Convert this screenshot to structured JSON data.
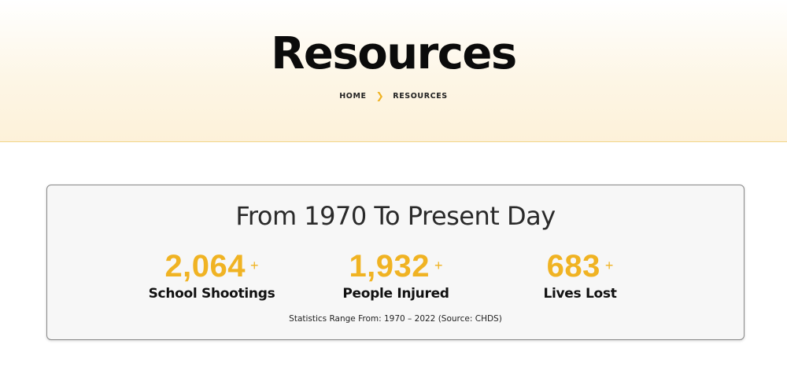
{
  "hero": {
    "title": "Resources",
    "breadcrumb": {
      "home_label": "HOME",
      "separator_icon": "chevron-right-icon",
      "current_label": "RESOURCES"
    }
  },
  "stats": {
    "heading": "From 1970 To Present Day",
    "items": [
      {
        "value": "2,064",
        "suffix": "+",
        "label": "School Shootings"
      },
      {
        "value": "1,932",
        "suffix": "+",
        "label": "People Injured"
      },
      {
        "value": "683",
        "suffix": "+",
        "label": "Lives Lost"
      }
    ],
    "footnote": "Statistics Range From: 1970 – 2022 (Source: CHDS)"
  },
  "colors": {
    "accent": "#f0b323",
    "hero_bg": "#fdf1d9",
    "card_bg": "#f7f7f7"
  }
}
